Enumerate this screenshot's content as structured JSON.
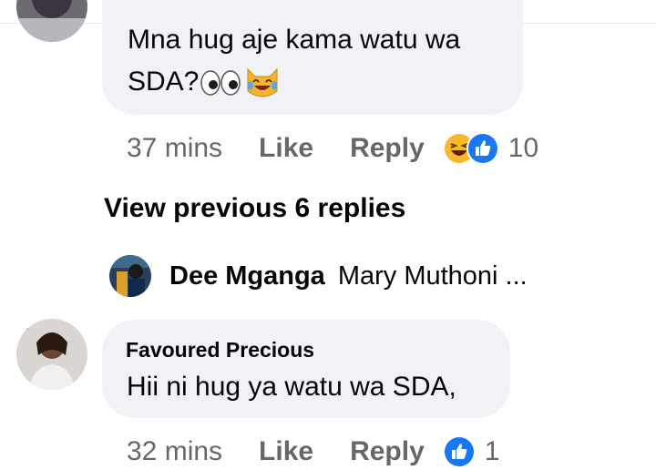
{
  "comment_top": {
    "text_line1": "Mna hug aje kama watu wa",
    "text_line2": "SDA?",
    "emoji_icons": [
      "eyes-emoji-icon",
      "laughing-cat-emoji-icon"
    ],
    "time": "37 mins",
    "like_label": "Like",
    "reply_label": "Reply",
    "reaction_icons": [
      "haha-reaction-icon",
      "like-reaction-icon"
    ],
    "reaction_count": "10"
  },
  "view_previous_label": "View previous 6 replies",
  "collapsed_reply": {
    "author": "Dee Mganga",
    "preview": "Mary Muthoni ..."
  },
  "comment_bottom": {
    "author": "Favoured Precious",
    "text": "Hii ni hug ya watu wa SDA,",
    "time": "32 mins",
    "like_label": "Like",
    "reply_label": "Reply",
    "reaction_icons": [
      "like-reaction-icon"
    ],
    "reaction_count": "1"
  },
  "colors": {
    "bubble_bg": "#f0f2f5",
    "meta_text": "#65676b",
    "like_blue": "#1877f2",
    "haha_yellow": "#f7b928"
  }
}
